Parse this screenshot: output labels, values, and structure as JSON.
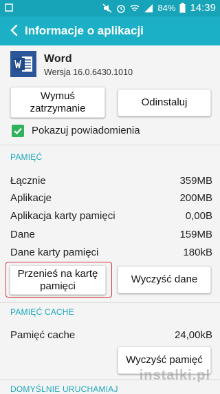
{
  "status_bar": {
    "battery": "84%",
    "time": "14:39",
    "icons": [
      "notification-icon",
      "muted-icon",
      "alarm-icon",
      "wifi-icon",
      "signal-icon",
      "battery-icon"
    ]
  },
  "appbar": {
    "title": "Informacje o aplikacji"
  },
  "app": {
    "name": "Word",
    "version": "Wersja 16.0.6430.1010"
  },
  "buttons": {
    "force_stop": "Wymuś\nzatrzymanie",
    "uninstall": "Odinstaluj",
    "move_to_card": "Przenieś na kartę\npamięci",
    "clear_data": "Wyczyść dane",
    "clear_cache": "Wyczyść pamięć"
  },
  "notifications": {
    "label": "Pokazuj powiadomienia",
    "checked": true
  },
  "storage": {
    "title": "PAMIĘĆ",
    "rows": [
      {
        "label": "Łącznie",
        "value": "359MB"
      },
      {
        "label": "Aplikacje",
        "value": "200MB"
      },
      {
        "label": "Aplikacja karty pamięci",
        "value": "0,00B"
      },
      {
        "label": "Dane",
        "value": "159MB"
      },
      {
        "label": "Dane karty pamięci",
        "value": "180kB"
      }
    ]
  },
  "cache": {
    "title": "PAMIĘĆ CACHE",
    "label": "Pamięć cache",
    "value": "24,00kB"
  },
  "defaults": {
    "title": "DOMYŚLNIE URUCHAMIAJ"
  },
  "watermark": "instalki.pl",
  "colors": {
    "statusbar": "#17a3b8",
    "appbar": "#1bb0c6",
    "accent": "#1aa7bd",
    "checkbox": "#2fb35c",
    "highlight": "#d9363e"
  }
}
